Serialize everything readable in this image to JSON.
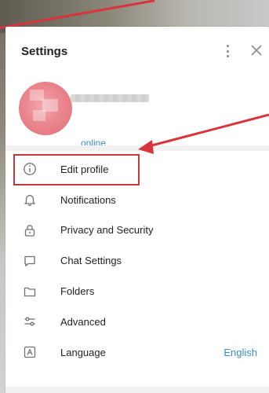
{
  "settings_panel": {
    "title": "Settings",
    "more_icon": "more-vertical-icon",
    "close_icon": "close-icon"
  },
  "profile": {
    "status": "online"
  },
  "menu": {
    "items": [
      {
        "label": "Edit profile",
        "icon": "info-icon"
      },
      {
        "label": "Notifications",
        "icon": "bell-icon"
      },
      {
        "label": "Privacy and Security",
        "icon": "lock-icon"
      },
      {
        "label": "Chat Settings",
        "icon": "chat-bubble-icon"
      },
      {
        "label": "Folders",
        "icon": "folder-icon"
      },
      {
        "label": "Advanced",
        "icon": "sliders-icon"
      },
      {
        "label": "Language",
        "icon": "language-icon",
        "value": "English"
      }
    ]
  },
  "colors": {
    "accent": "#3a8fc6",
    "annotation": "#c8373b"
  }
}
